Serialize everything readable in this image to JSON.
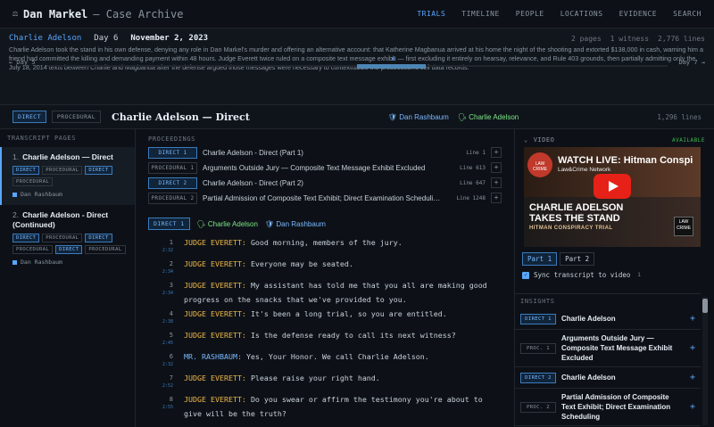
{
  "brand": {
    "name": "Dan Markel",
    "subtitle": "— Case Archive"
  },
  "nav": [
    "TRIALS",
    "TIMELINE",
    "PEOPLE",
    "LOCATIONS",
    "EVIDENCE",
    "SEARCH"
  ],
  "header": {
    "witness": "Charlie Adelson",
    "day": "Day 6",
    "date": "November 2, 2023",
    "pages": "2 pages",
    "witnesses": "1 witness",
    "lines": "2,776 lines",
    "summary": "Charlie Adelson took the stand in his own defense, denying any role in Dan Markel's murder and offering an alternative account: that Katherine Magbanua arrived at his home the night of the shooting and extorted $138,000 in cash, warning him a friend had committed the killing and demanding payment within 48 hours. Judge Everett twice ruled on a composite text message exhibit — first excluding it entirely on hearsay, relevance, and Rule 403 grounds, then partially admitting only the July 18, 2014 texts between Charlie and Magbanua after the defense argued those messages were necessary to contextualize the prosecution's cell data records.",
    "prev_day": "← Day 5",
    "next_day": "Day 7 →",
    "day_marker": "6",
    "day_progress": {
      "current": 6,
      "first": 1,
      "last": 10
    }
  },
  "titlebar": {
    "tag_direct": "DIRECT",
    "tag_procedural": "PROCEDURAL",
    "title": "Charlie Adelson — Direct",
    "party_prosecution": "Dan Rashbaum",
    "party_witness": "Charlie Adelson",
    "lines": "1,296 lines"
  },
  "transcript_pages": {
    "heading": "TRANSCRIPT PAGES",
    "pages": [
      {
        "num": "1.",
        "title": "Charlie Adelson — Direct",
        "tags": [
          "DIRECT",
          "PROCEDURAL",
          "DIRECT",
          "PROCEDURAL"
        ],
        "who": "Dan Rashbaum"
      },
      {
        "num": "2.",
        "title": "Charlie Adelson - Direct (Continued)",
        "tags": [
          "DIRECT",
          "PROCEDURAL",
          "DIRECT",
          "PROCEDURAL",
          "DIRECT",
          "PROCEDURAL"
        ],
        "who": "Dan Rashbaum"
      }
    ]
  },
  "proceedings": {
    "heading": "PROCEEDINGS",
    "items": [
      {
        "tag": "DIRECT 1",
        "text": "Charlie Adelson - Direct (Part 1)",
        "line": "Line 1"
      },
      {
        "tag": "PROCEDURAL 1",
        "text": "Arguments Outside Jury — Composite Text Message Exhibit Excluded",
        "line": "Line 613"
      },
      {
        "tag": "DIRECT 2",
        "text": "Charlie Adelson - Direct (Part 2)",
        "line": "Line 647"
      },
      {
        "tag": "PROCEDURAL 2",
        "text": "Partial Admission of Composite Text Exhibit; Direct Examination Scheduli…",
        "line": "Line 1248"
      }
    ]
  },
  "section": {
    "tag": "DIRECT 1",
    "witness": "Charlie Adelson",
    "examiner": "Dan Rashbaum"
  },
  "transcript": [
    {
      "n": "1",
      "t": "2:32",
      "speaker": "JUDGE EVERETT:",
      "text": "Good morning, members of the jury."
    },
    {
      "n": "2",
      "t": "2:34",
      "speaker": "JUDGE EVERETT:",
      "text": "Everyone may be seated."
    },
    {
      "n": "3",
      "t": "2:34",
      "speaker": "JUDGE EVERETT:",
      "text": "My assistant has told me that you all are making good progress on the snacks that we've provided to you."
    },
    {
      "n": "4",
      "t": "2:38",
      "speaker": "JUDGE EVERETT:",
      "text": "It's been a long trial, so you are entitled."
    },
    {
      "n": "5",
      "t": "2:45",
      "speaker": "JUDGE EVERETT:",
      "text": "Is the defense ready to call its next witness?"
    },
    {
      "n": "6",
      "t": "2:32",
      "speaker": "MR. RASHBAUM:",
      "text": "Yes, Your Honor. We call Charlie Adelson."
    },
    {
      "n": "7",
      "t": "2:52",
      "speaker": "JUDGE EVERETT:",
      "text": "Please raise your right hand."
    },
    {
      "n": "8",
      "t": "2:55",
      "speaker": "JUDGE EVERETT:",
      "text": "Do you swear or affirm the testimony you're about to give will be the truth?"
    }
  ],
  "video": {
    "heading": "VIDEO",
    "status": "AVAILABLE",
    "live_title": "WATCH LIVE: Hitman Conspi",
    "channel": "Law&Crime Network",
    "headline_1": "CHARLIE ADELSON",
    "headline_2": "TAKES THE STAND",
    "subhead": "HITMAN CONSPIRACY TRIAL",
    "logo_text": "LAW CRIME",
    "parts": [
      "Part 1",
      "Part 2"
    ],
    "sync_label": "Sync transcript to video",
    "info": "i"
  },
  "insights": {
    "heading": "INSIGHTS",
    "items": [
      {
        "tag": "DIRECT 1",
        "text": "Charlie Adelson"
      },
      {
        "tag": "PROC. 1",
        "text": "Arguments Outside Jury — Composite Text Message Exhibit Excluded"
      },
      {
        "tag": "DIRECT 2",
        "text": "Charlie Adelson"
      },
      {
        "tag": "PROC. 2",
        "text": "Partial Admission of Composite Text Exhibit; Direct Examination Scheduling"
      }
    ]
  },
  "colors": {
    "accent": "#58a6ff",
    "speaker": "#f0b849",
    "witness": "#7ee787",
    "bg": "#0d1117"
  },
  "icons": {
    "brand": "scale-icon",
    "prosecution": "shield-icon",
    "witness": "person-icon",
    "collapse": "chevron-down-icon",
    "add": "plus-icon"
  }
}
